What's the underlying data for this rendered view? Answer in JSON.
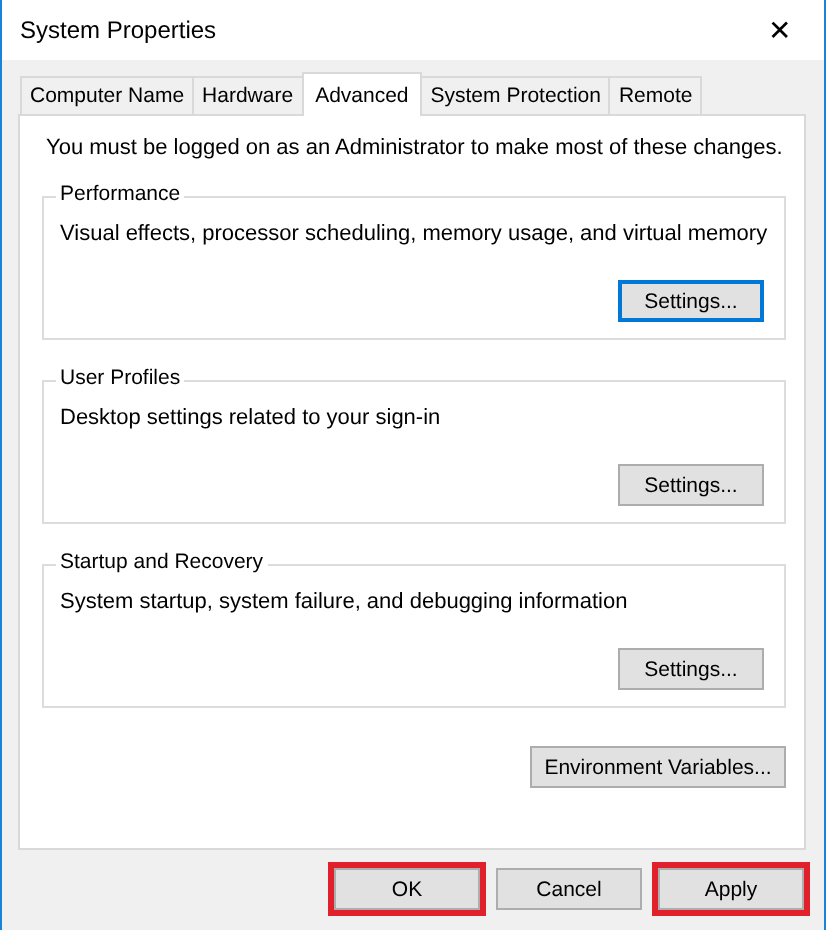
{
  "window": {
    "title": "System Properties",
    "close": "✕"
  },
  "tabs": [
    {
      "label": "Computer Name",
      "selected": false
    },
    {
      "label": "Hardware",
      "selected": false
    },
    {
      "label": "Advanced",
      "selected": true
    },
    {
      "label": "System Protection",
      "selected": false
    },
    {
      "label": "Remote",
      "selected": false
    }
  ],
  "notice": "You must be logged on as an Administrator to make most of these changes.",
  "groups": [
    {
      "title": "Performance",
      "description": "Visual effects, processor scheduling, memory usage, and virtual memory",
      "button": "Settings...",
      "focused": true
    },
    {
      "title": "User Profiles",
      "description": "Desktop settings related to your sign-in",
      "button": "Settings...",
      "focused": false
    },
    {
      "title": "Startup and Recovery",
      "description": "System startup, system failure, and debugging information",
      "button": "Settings...",
      "focused": false
    }
  ],
  "environment_button": "Environment Variables...",
  "buttons": [
    {
      "label": "OK",
      "highlighted": true
    },
    {
      "label": "Cancel",
      "highlighted": false
    },
    {
      "label": "Apply",
      "highlighted": true
    }
  ]
}
